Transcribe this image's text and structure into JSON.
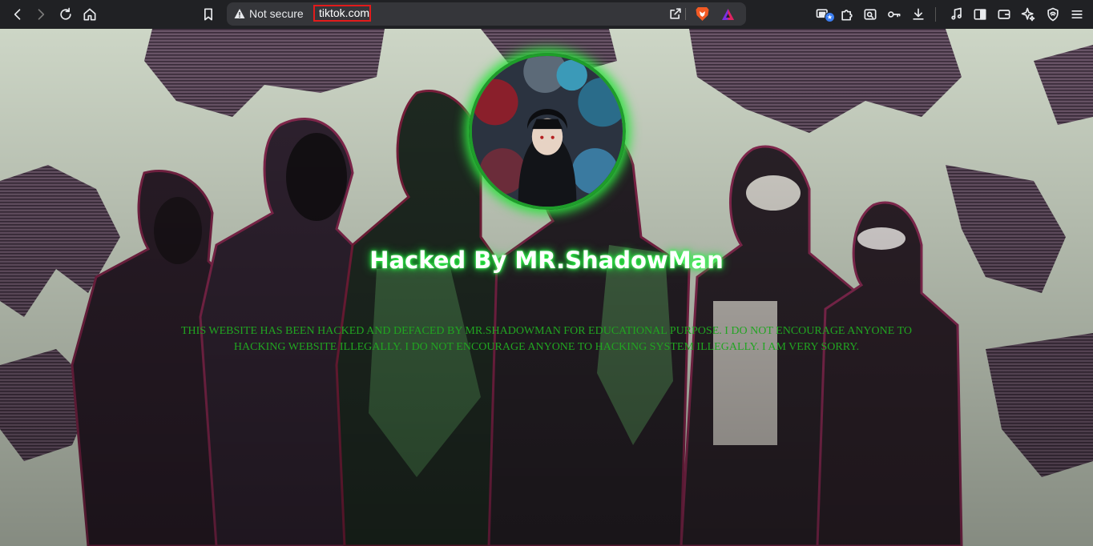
{
  "browser": {
    "security_label": "Not secure",
    "url": "tiktok.com",
    "icons": {
      "back": "back-arrow-icon",
      "forward": "forward-arrow-icon",
      "reload": "reload-icon",
      "home": "home-icon",
      "bookmark": "bookmark-icon",
      "warning": "warning-triangle-icon",
      "share": "share-icon",
      "brave_shields": "brave-lion-icon",
      "brave_rewards": "brave-rewards-icon",
      "extensions": [
        "media-tab-icon",
        "extensions-puzzle-icon",
        "screen-capture-icon",
        "key-icon",
        "download-icon",
        "music-note-icon",
        "sidebar-icon",
        "wallet-icon",
        "leo-ai-icon",
        "vpn-shield-icon",
        "menu-icon"
      ]
    },
    "colors": {
      "toolbar": "#202124",
      "omnibox": "#35363a",
      "url_highlight": "#e21b1b"
    }
  },
  "page": {
    "headline": "Hacked By MR.ShadowMan",
    "message_line_1": "THIS WEBSITE HAS BEEN HACKED AND DEFACED BY MR.SHADOWMAN FOR EDUCATIONAL PURPOSE. I DO NOT ENCOURAGE ANYONE TO",
    "message_line_2": "HACKING WEBSITE ILLEGALLY. I DO NOT ENCOURAGE ANYONE TO HACKING SYSTEM ILLEGALLY. I AM VERY SORRY.",
    "colors": {
      "headline_glow": "#29ff45",
      "message": "#21a521",
      "avatar_ring": "#1e9d2a"
    }
  }
}
